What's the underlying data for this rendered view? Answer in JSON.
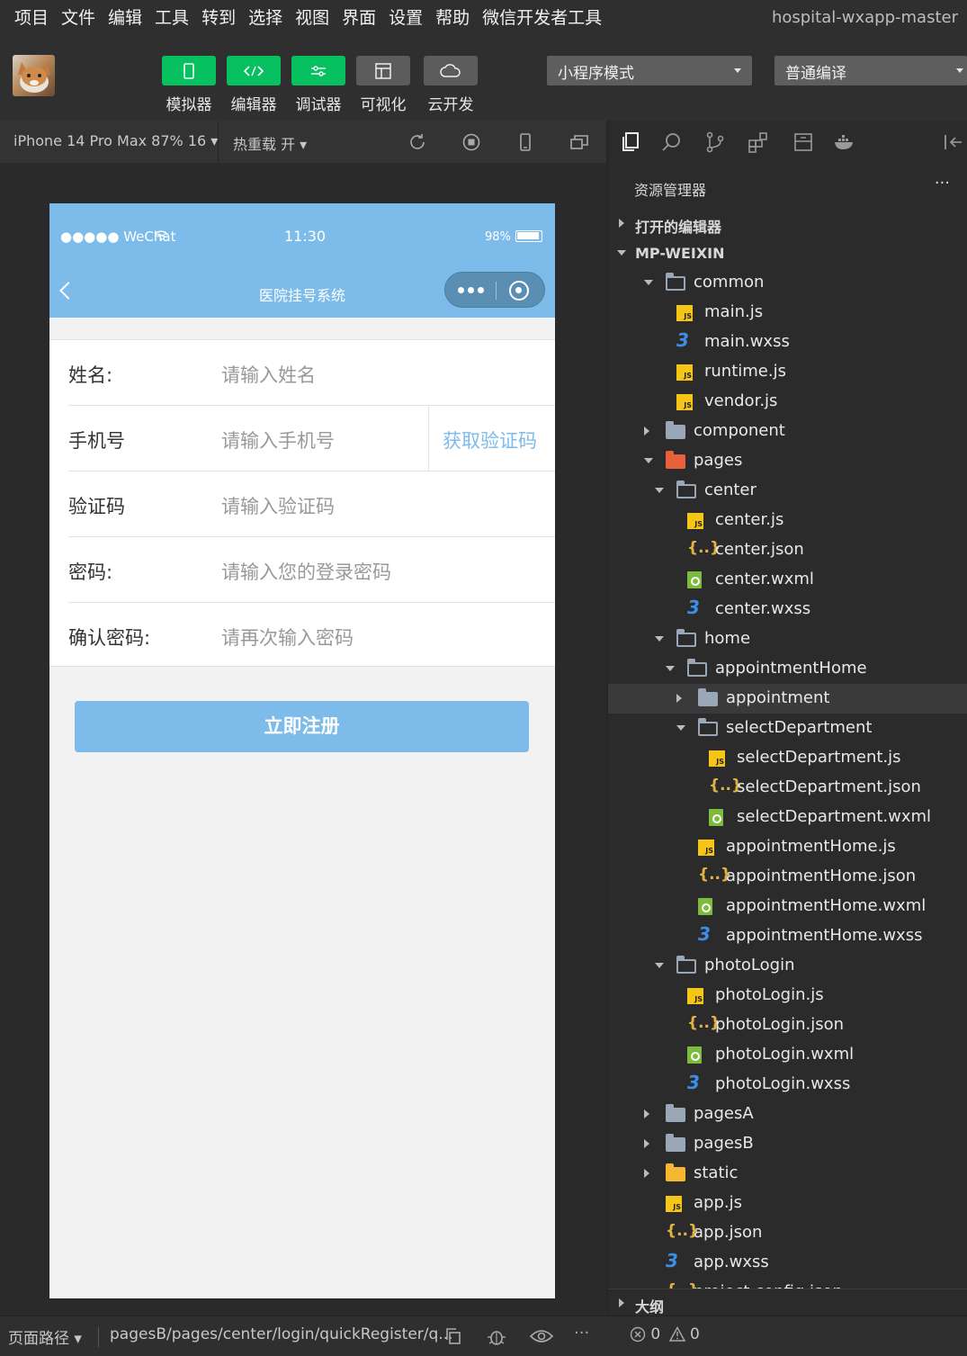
{
  "menubar": {
    "items": [
      "项目",
      "文件",
      "编辑",
      "工具",
      "转到",
      "选择",
      "视图",
      "界面",
      "设置",
      "帮助",
      "微信开发者工具"
    ],
    "window_title": "hospital-wxapp-master"
  },
  "toolbar": {
    "buttons": [
      {
        "label": "模拟器",
        "icon": "phone-icon",
        "style": "green"
      },
      {
        "label": "编辑器",
        "icon": "code-icon",
        "style": "green"
      },
      {
        "label": "调试器",
        "icon": "debug-icon",
        "style": "green"
      },
      {
        "label": "可视化",
        "icon": "layout-icon",
        "style": "gray"
      },
      {
        "label": "云开发",
        "icon": "cloud-icon",
        "style": "gray"
      }
    ],
    "mode_select": "小程序模式",
    "compile_select": "普通编译"
  },
  "simbar": {
    "device": "iPhone 14 Pro Max 87% 16",
    "hot_reload": "热重载 开"
  },
  "phone": {
    "carrier": "●●●●● WeChat",
    "time": "11:30",
    "battery": "98%",
    "nav_title": "医院挂号系统",
    "form": [
      {
        "label": "姓名:",
        "placeholder": "请输入姓名"
      },
      {
        "label": "手机号",
        "placeholder": "请输入手机号"
      },
      {
        "label": "验证码",
        "placeholder": "请输入验证码"
      },
      {
        "label": "密码:",
        "placeholder": "请输入您的登录密码"
      },
      {
        "label": "确认密码:",
        "placeholder": "请再次输入密码"
      }
    ],
    "code_button": "获取验证码",
    "register_button": "立即注册"
  },
  "explorer": {
    "title": "资源管理器",
    "more": "···",
    "open_editors": "打开的编辑器",
    "project": "MP-WEIXIN",
    "tree": [
      {
        "label": "common",
        "type": "folder-open",
        "depth": 1,
        "caret": "down"
      },
      {
        "label": "main.js",
        "type": "js",
        "depth": 2
      },
      {
        "label": "main.wxss",
        "type": "wxss",
        "depth": 2
      },
      {
        "label": "runtime.js",
        "type": "js",
        "depth": 2
      },
      {
        "label": "vendor.js",
        "type": "js",
        "depth": 2
      },
      {
        "label": "component",
        "type": "folder",
        "depth": 1,
        "caret": "right"
      },
      {
        "label": "pages",
        "type": "pages",
        "depth": 1,
        "caret": "down"
      },
      {
        "label": "center",
        "type": "folder-open",
        "depth": 2,
        "caret": "down"
      },
      {
        "label": "center.js",
        "type": "js",
        "depth": 3
      },
      {
        "label": "center.json",
        "type": "json",
        "depth": 3
      },
      {
        "label": "center.wxml",
        "type": "wxml",
        "depth": 3
      },
      {
        "label": "center.wxss",
        "type": "wxss",
        "depth": 3
      },
      {
        "label": "home",
        "type": "folder-open",
        "depth": 2,
        "caret": "down"
      },
      {
        "label": "appointmentHome",
        "type": "folder-open",
        "depth": 3,
        "caret": "down"
      },
      {
        "label": "appointment",
        "type": "folder",
        "depth": 4,
        "caret": "right",
        "selected": true
      },
      {
        "label": "selectDepartment",
        "type": "folder-open",
        "depth": 4,
        "caret": "down"
      },
      {
        "label": "selectDepartment.js",
        "type": "js",
        "depth": 5
      },
      {
        "label": "selectDepartment.json",
        "type": "json",
        "depth": 5
      },
      {
        "label": "selectDepartment.wxml",
        "type": "wxml",
        "depth": 5
      },
      {
        "label": "appointmentHome.js",
        "type": "js",
        "depth": 4
      },
      {
        "label": "appointmentHome.json",
        "type": "json",
        "depth": 4
      },
      {
        "label": "appointmentHome.wxml",
        "type": "wxml",
        "depth": 4
      },
      {
        "label": "appointmentHome.wxss",
        "type": "wxss",
        "depth": 4
      },
      {
        "label": "photoLogin",
        "type": "folder-open",
        "depth": 2,
        "caret": "down"
      },
      {
        "label": "photoLogin.js",
        "type": "js",
        "depth": 3
      },
      {
        "label": "photoLogin.json",
        "type": "json",
        "depth": 3
      },
      {
        "label": "photoLogin.wxml",
        "type": "wxml",
        "depth": 3
      },
      {
        "label": "photoLogin.wxss",
        "type": "wxss",
        "depth": 3
      },
      {
        "label": "pagesA",
        "type": "folder",
        "depth": 1,
        "caret": "right"
      },
      {
        "label": "pagesB",
        "type": "folder",
        "depth": 1,
        "caret": "right"
      },
      {
        "label": "static",
        "type": "static",
        "depth": 1,
        "caret": "right"
      },
      {
        "label": "app.js",
        "type": "js",
        "depth": 1
      },
      {
        "label": "app.json",
        "type": "json",
        "depth": 1
      },
      {
        "label": "app.wxss",
        "type": "wxss",
        "depth": 1
      },
      {
        "label": "project.config.json",
        "type": "json",
        "depth": 1
      }
    ],
    "outline": "大纲"
  },
  "bottombar": {
    "page_path_label": "页面路径 ▾",
    "page_path": "pagesB/pages/center/login/quickRegister/q...",
    "errors": "0",
    "warnings": "0"
  },
  "colors": {
    "accent": "#07c160",
    "phone_theme": "#7dbcea"
  }
}
